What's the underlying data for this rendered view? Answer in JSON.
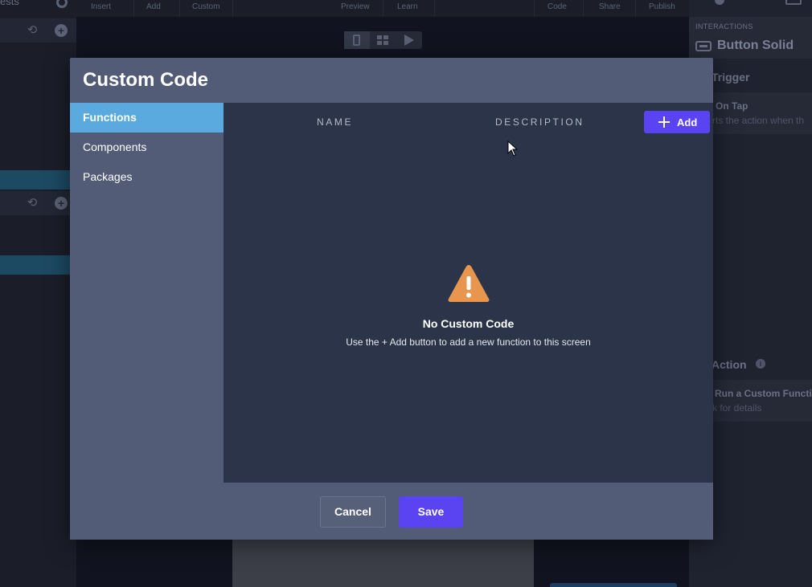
{
  "app": {
    "top_left_text": "ests",
    "menu": [
      "Insert",
      "Add",
      "Custom",
      "Preview",
      "Learn",
      "Code",
      "Share",
      "Publish"
    ]
  },
  "right_panel": {
    "section_label": "INTERACTIONS",
    "element_title": "Button Solid",
    "trigger_label": "Trigger",
    "trigger_card_title": "On Tap",
    "trigger_card_sub": "rts the action when th",
    "action_label": "Action",
    "action_card_title": "Run a Custom Functi",
    "action_card_sub": "k for details"
  },
  "modal": {
    "title": "Custom Code",
    "tabs": [
      {
        "label": "Functions",
        "active": true
      },
      {
        "label": "Components",
        "active": false
      },
      {
        "label": "Packages",
        "active": false
      }
    ],
    "columns": {
      "name": "NAME",
      "description": "DESCRIPTION"
    },
    "add_label": "Add",
    "empty_title": "No Custom Code",
    "empty_desc": "Use the + Add button to add a new function to this screen",
    "cancel_label": "Cancel",
    "save_label": "Save"
  },
  "colors": {
    "accent": "#5a43f0",
    "active_tab": "#5aaae0",
    "warning": "#e8964e",
    "modal_bg": "#525c77",
    "content_bg": "#2c3449"
  }
}
